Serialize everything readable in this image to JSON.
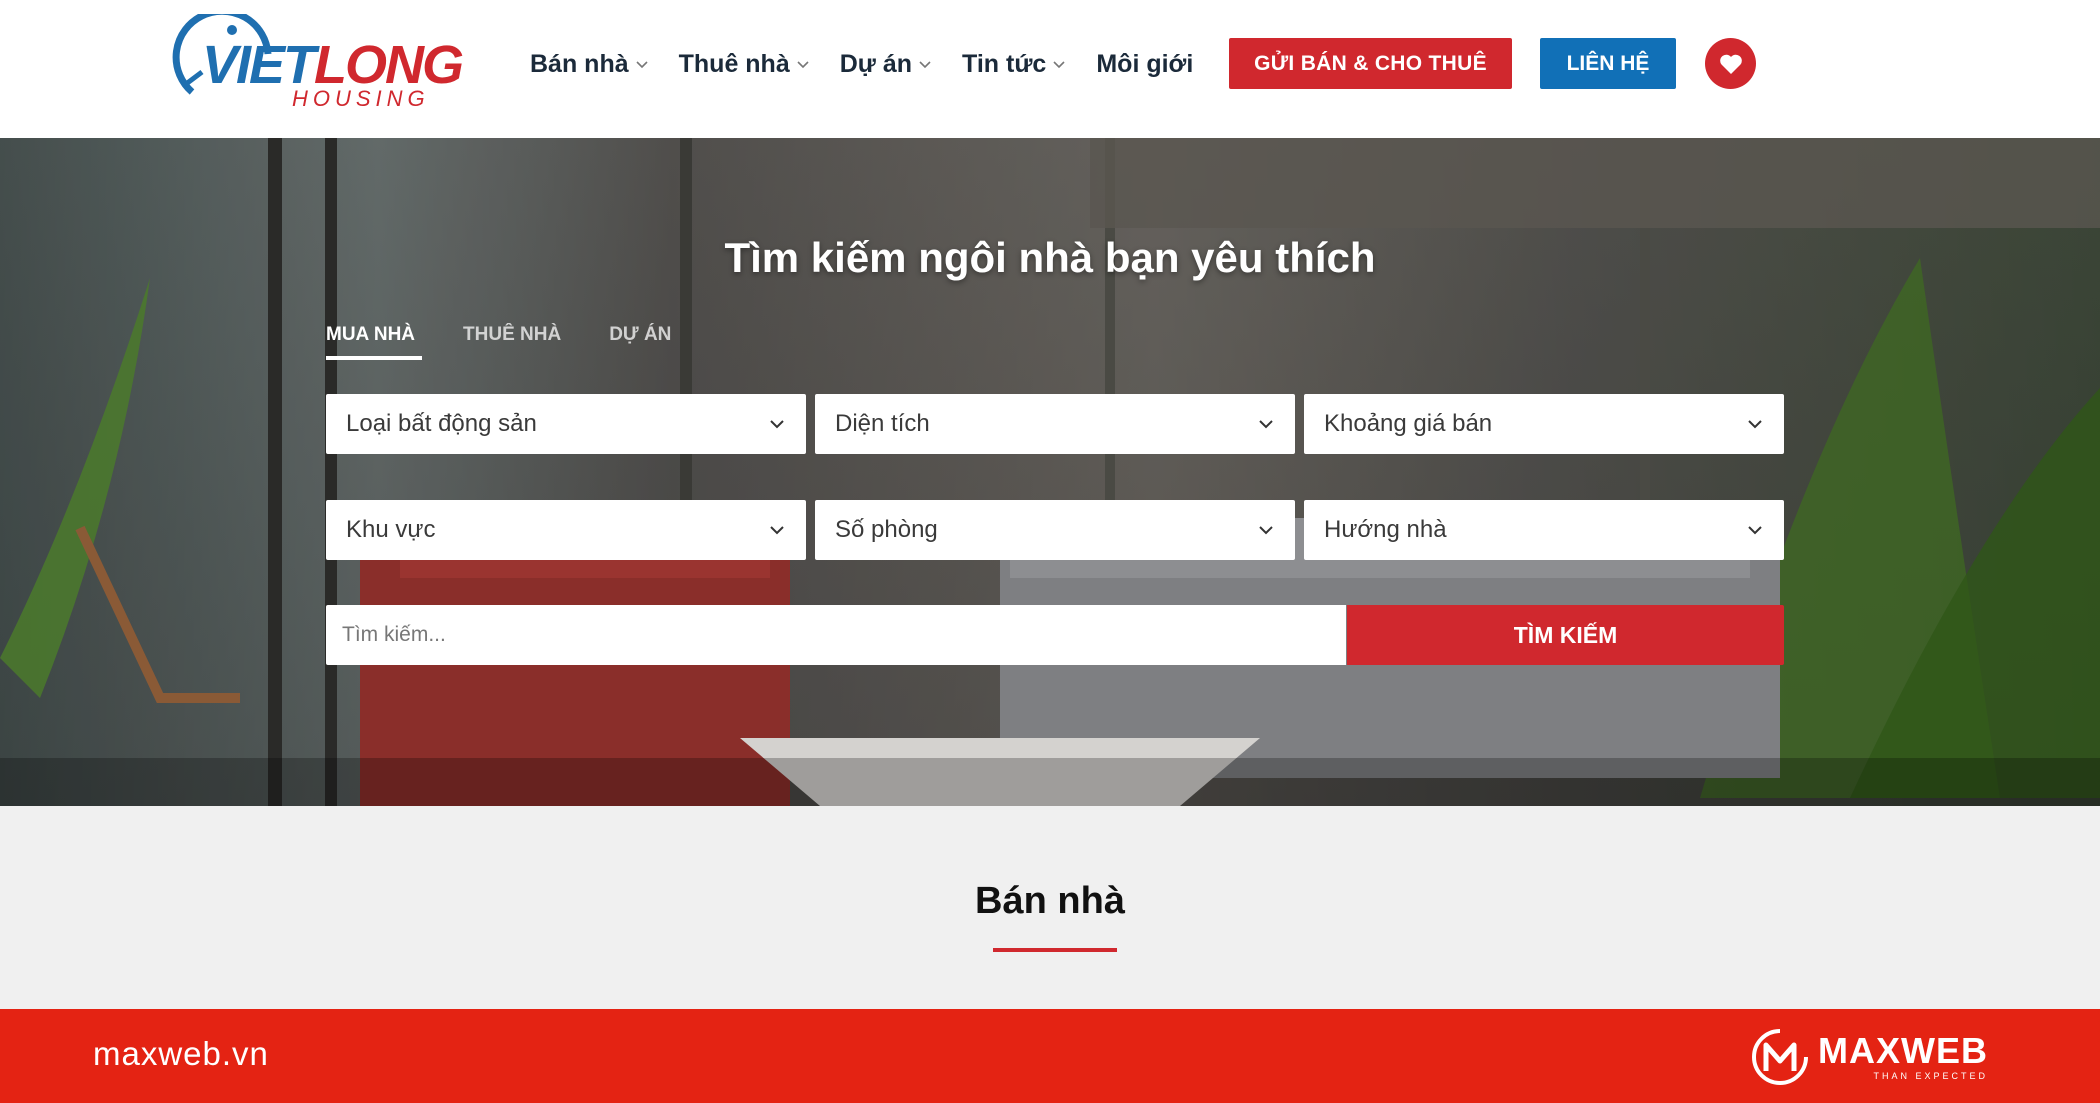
{
  "header": {
    "logo": {
      "primary": "VIETLONG",
      "part1": "VIET",
      "part2": "LONG",
      "sub": "HOUSING"
    },
    "nav": [
      {
        "label": "Bán nhà",
        "has_dropdown": true
      },
      {
        "label": "Thuê nhà",
        "has_dropdown": true
      },
      {
        "label": "Dự án",
        "has_dropdown": true
      },
      {
        "label": "Tin tức",
        "has_dropdown": true
      },
      {
        "label": "Môi giới",
        "has_dropdown": false
      }
    ],
    "cta_submit": "GỬI BÁN & CHO THUÊ",
    "cta_contact": "LIÊN HỆ",
    "favorite_icon": "heart-icon"
  },
  "hero": {
    "title": "Tìm kiếm ngôi nhà bạn yêu thích",
    "tabs": [
      {
        "label": "MUA NHÀ",
        "active": true
      },
      {
        "label": "THUÊ NHÀ",
        "active": false
      },
      {
        "label": "DỰ ÁN",
        "active": false
      }
    ],
    "filters_row1": [
      {
        "label": "Loại bất động sản"
      },
      {
        "label": "Diện tích"
      },
      {
        "label": "Khoảng giá bán"
      }
    ],
    "filters_row2": [
      {
        "label": "Khu vực"
      },
      {
        "label": "Số phòng"
      },
      {
        "label": "Hướng nhà"
      }
    ],
    "search_placeholder": "Tìm kiếm...",
    "search_button": "TÌM KIẾM"
  },
  "section": {
    "title": "Bán nhà"
  },
  "footer": {
    "site": "maxweb.vn",
    "brand_name": "MAXWEB",
    "brand_tagline": "THAN EXPECTED"
  },
  "colors": {
    "brand_red": "#d0282e",
    "brand_blue": "#1170b7",
    "footer_red": "#e42313",
    "nav_text": "#1b2a3a"
  }
}
